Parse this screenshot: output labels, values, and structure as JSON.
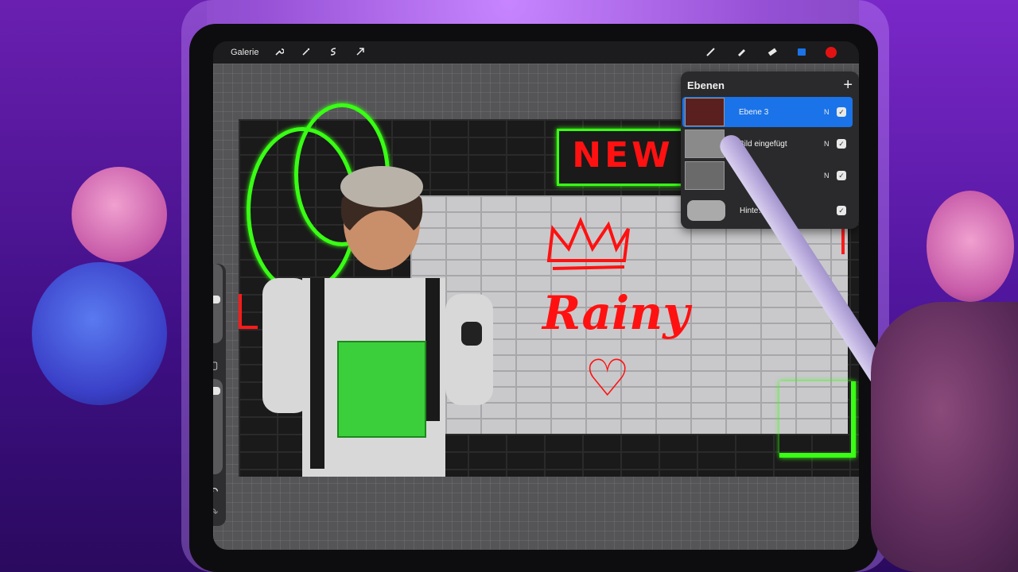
{
  "toolbar": {
    "gallery_label": "Galerie",
    "left_icons": [
      "wrench-icon",
      "magic-wand-icon",
      "selection-icon",
      "transform-arrow-icon"
    ],
    "right_icons": [
      "brush-icon",
      "smudge-icon",
      "eraser-icon",
      "layers-icon"
    ],
    "color_swatch": "#e31212"
  },
  "layers_panel": {
    "title": "Ebenen",
    "add_label": "+",
    "layers": [
      {
        "name": "Ebene 3",
        "mode": "N",
        "visible": true,
        "active": true
      },
      {
        "name": "Bild eingefügt",
        "mode": "N",
        "visible": true,
        "active": false
      },
      {
        "name": "",
        "mode": "N",
        "visible": true,
        "active": false
      },
      {
        "name": "Hinte…be",
        "visible": true,
        "active": false
      }
    ]
  },
  "canvas": {
    "text_top": "NEW",
    "text_main": "Rainy",
    "heart": "♡"
  },
  "sidebar": {
    "undo_label": "↶",
    "redo_label": "↷",
    "square_label": "▢"
  },
  "colors": {
    "accent_blue": "#1a73e8",
    "neon_green": "#39ff14",
    "red": "#ff1111"
  }
}
